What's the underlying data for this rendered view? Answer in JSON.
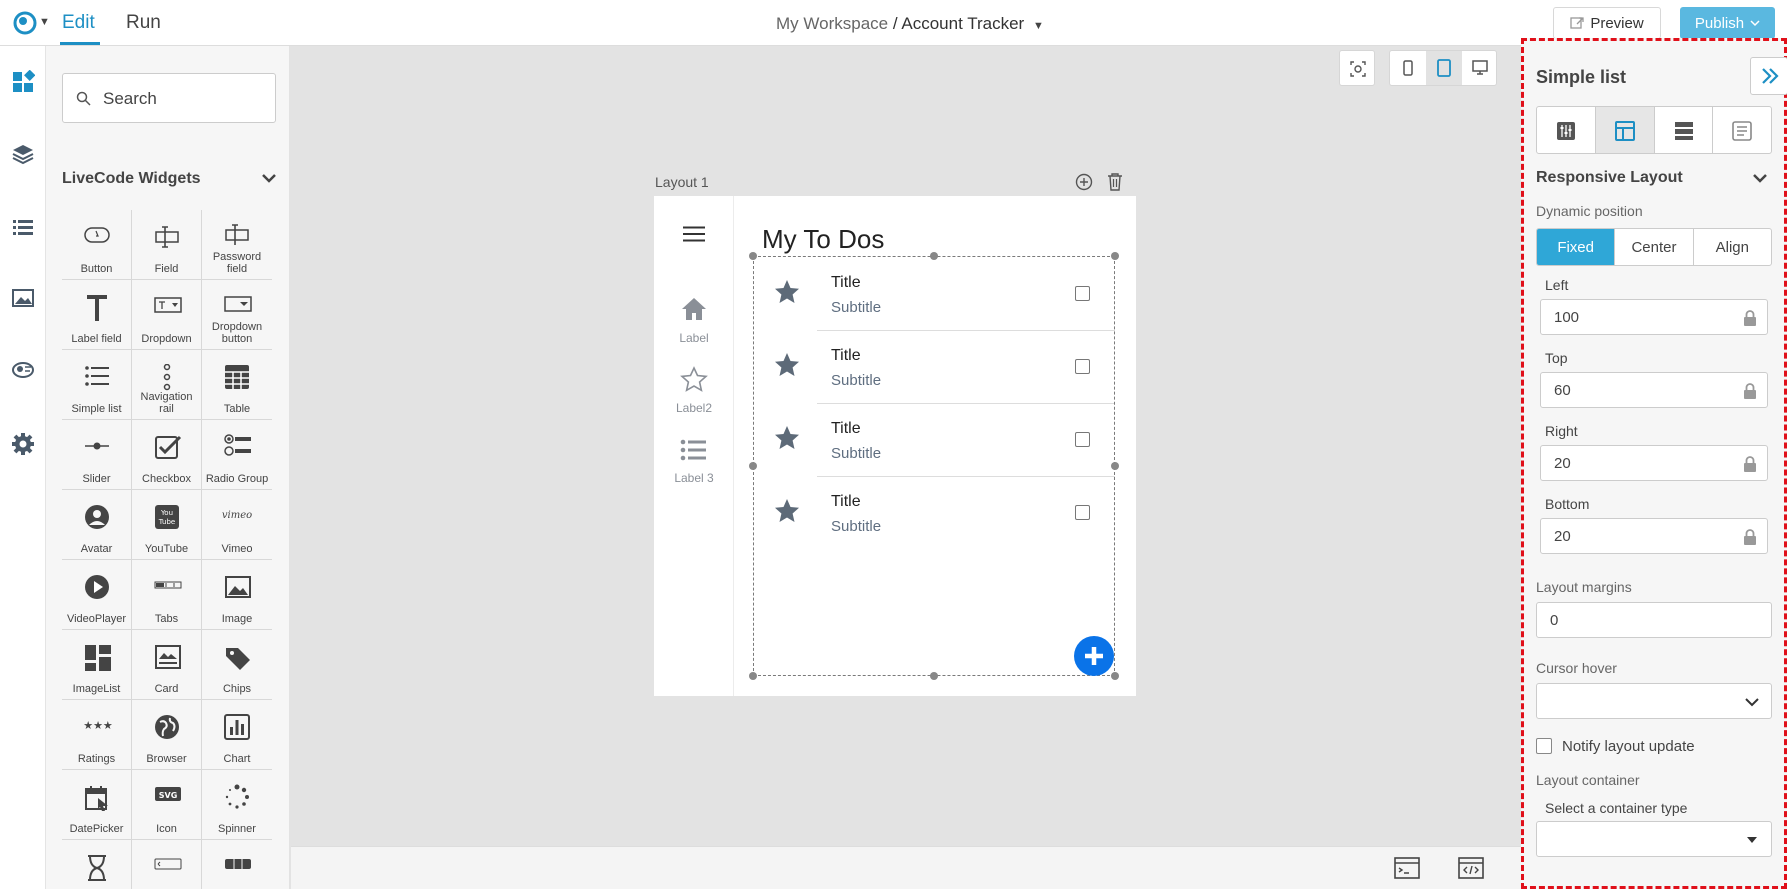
{
  "topbar": {
    "mode_edit": "Edit",
    "mode_run": "Run",
    "workspace": "My Workspace",
    "separator": "/",
    "project": "Account Tracker",
    "preview_label": "Preview",
    "publish_label": "Publish"
  },
  "rail": {
    "icons": [
      "widgets-icon",
      "layers-icon",
      "list-icon",
      "image-icon",
      "components-icon",
      "gear-icon"
    ]
  },
  "widgets": {
    "search_placeholder": "Search",
    "section_title": "LiveCode Widgets",
    "items": [
      {
        "label": "Button"
      },
      {
        "label": "Field"
      },
      {
        "label": "Password field"
      },
      {
        "label": "Label field"
      },
      {
        "label": "Dropdown"
      },
      {
        "label": "Dropdown button"
      },
      {
        "label": "Simple list"
      },
      {
        "label": "Navigation rail"
      },
      {
        "label": "Table"
      },
      {
        "label": "Slider"
      },
      {
        "label": "Checkbox"
      },
      {
        "label": "Radio Group"
      },
      {
        "label": "Avatar"
      },
      {
        "label": "YouTube"
      },
      {
        "label": "Vimeo"
      },
      {
        "label": "VideoPlayer"
      },
      {
        "label": "Tabs"
      },
      {
        "label": "Image"
      },
      {
        "label": "ImageList"
      },
      {
        "label": "Card"
      },
      {
        "label": "Chips"
      },
      {
        "label": "Ratings"
      },
      {
        "label": "Browser"
      },
      {
        "label": "Chart"
      },
      {
        "label": "DatePicker"
      },
      {
        "label": "Icon"
      },
      {
        "label": "Spinner"
      },
      {
        "label": ""
      },
      {
        "label": ""
      },
      {
        "label": ""
      }
    ]
  },
  "canvas": {
    "layout_label": "Layout 1",
    "nav": [
      {
        "label": "Label"
      },
      {
        "label": "Label2"
      },
      {
        "label": "Label 3"
      }
    ],
    "title": "My To Dos",
    "list": [
      {
        "title": "Title",
        "subtitle": "Subtitle"
      },
      {
        "title": "Title",
        "subtitle": "Subtitle"
      },
      {
        "title": "Title",
        "subtitle": "Subtitle"
      },
      {
        "title": "Title",
        "subtitle": "Subtitle"
      }
    ]
  },
  "props": {
    "title": "Simple list",
    "section": "Responsive Layout",
    "dynamic_position_label": "Dynamic position",
    "dynamic_position_options": [
      "Fixed",
      "Center",
      "Align"
    ],
    "dynamic_position_selected": "Fixed",
    "left_label": "Left",
    "left_value": "100",
    "top_label": "Top",
    "top_value": "60",
    "right_label": "Right",
    "right_value": "20",
    "bottom_label": "Bottom",
    "bottom_value": "20",
    "margins_label": "Layout margins",
    "margins_value": "0",
    "cursor_label": "Cursor hover",
    "cursor_value": "",
    "notify_label": "Notify layout update",
    "notify_checked": false,
    "container_label": "Layout container",
    "container_hint": "Select a container type",
    "container_value": ""
  },
  "colors": {
    "accent": "#1d8fc4",
    "publish": "#5ab8e0",
    "active_segment": "#2fa7d7",
    "fab": "#0a73e8",
    "selection_outline": "#e0101a"
  }
}
